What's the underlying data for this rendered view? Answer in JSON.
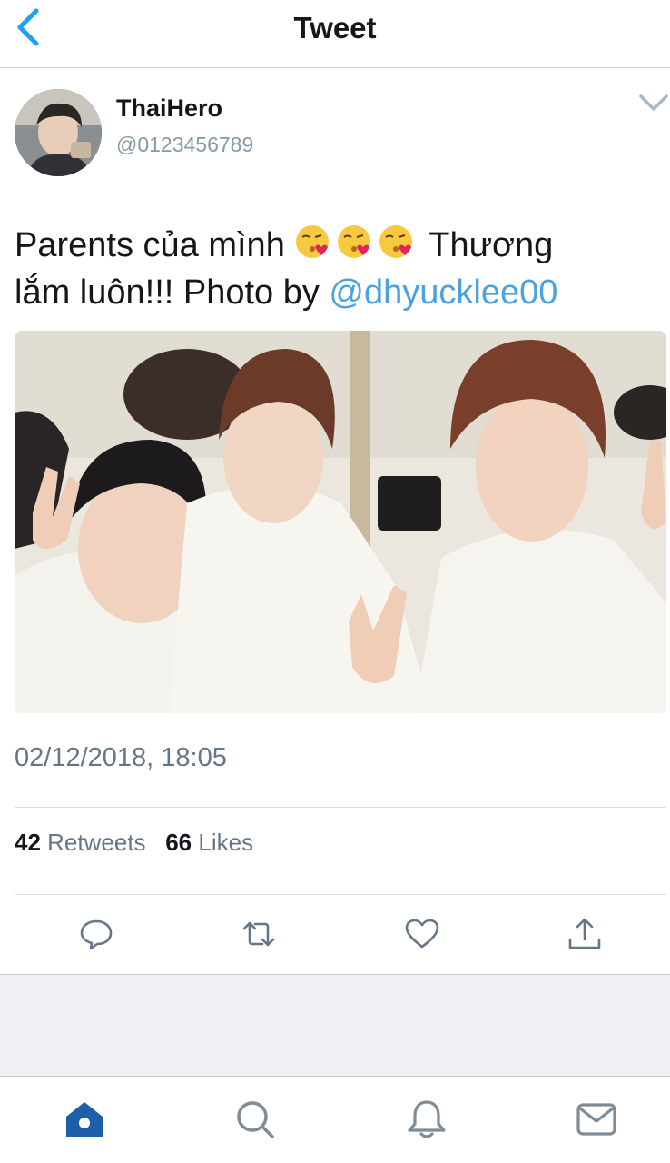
{
  "nav": {
    "title": "Tweet",
    "back_icon": "chevron-left-icon"
  },
  "author": {
    "name": "ThaiHero",
    "handle": "@0123456789"
  },
  "tweet": {
    "text_1": "Parents của mình",
    "text_2": "Thương",
    "text_3": "lắm luôn!!! Photo by",
    "mention": "@dhyucklee00"
  },
  "timestamp": "02/12/2018, 18:05",
  "stats": {
    "retweets_count": "42",
    "retweets_label": "Retweets",
    "likes_count": "66",
    "likes_label": "Likes"
  },
  "colors": {
    "accent": "#1da1f2",
    "mention": "#4aa3df",
    "tab_active": "#1d5fa8",
    "muted": "#657786"
  }
}
